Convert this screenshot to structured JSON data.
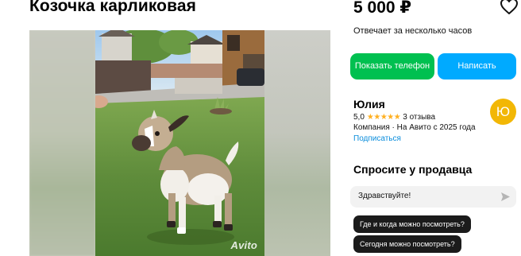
{
  "listing": {
    "title": "Козочка карликовая",
    "watermark": "Avito"
  },
  "offer": {
    "price": "5 000 ₽",
    "response_time": "Отвечает за несколько часов",
    "phone_button_label": "Показать телефон",
    "write_button_label": "Написать"
  },
  "seller": {
    "name": "Юлия",
    "rating": "5,0",
    "stars": "★★★★★",
    "reviews": "3 отзыва",
    "company_info": "Компания · На Авито с 2025 года",
    "subscribe_label": "Подписаться",
    "avatar_letter": "Ю",
    "avatar_color": "#f2b705"
  },
  "ask_seller": {
    "title": "Спросите у продавца",
    "input_value": "Здравствуйте!",
    "quick_questions": [
      "Где и когда можно посмотреть?",
      "Сегодня можно посмотреть?"
    ]
  },
  "icons": {
    "favorite": "heart-icon",
    "send": "send-icon",
    "star": "star-icon"
  },
  "colors": {
    "phone_button": "#00c050",
    "write_button": "#00aaff",
    "link": "#0a8ddc",
    "chip": "#1b1b1b"
  }
}
